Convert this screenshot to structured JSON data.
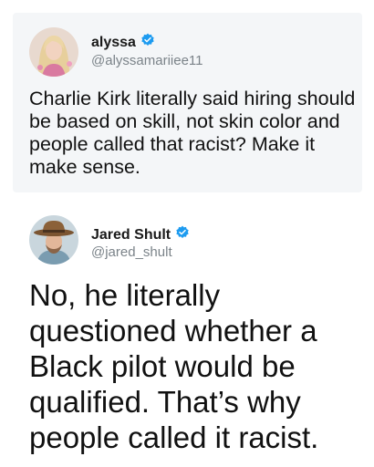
{
  "tweets": [
    {
      "name": "alyssa",
      "handle": "@alyssamariiee11",
      "verified_color": "#1d9bf0",
      "avatar": "woman-portrait-avatar",
      "text": "Charlie Kirk literally said hiring should be based on skill, not skin color and people called that racist? Make it make sense."
    },
    {
      "name": "Jared Shult",
      "handle": "@jared_shult",
      "verified_color": "#1d9bf0",
      "avatar": "man-cowboy-hat-avatar",
      "text": "No, he literally questioned whether a Black pilot would be qualified. That’s why people called it racist."
    }
  ],
  "colors": {
    "card_background": "#f4f6f8",
    "handle_text": "#7b8389",
    "body_text": "#111111"
  }
}
